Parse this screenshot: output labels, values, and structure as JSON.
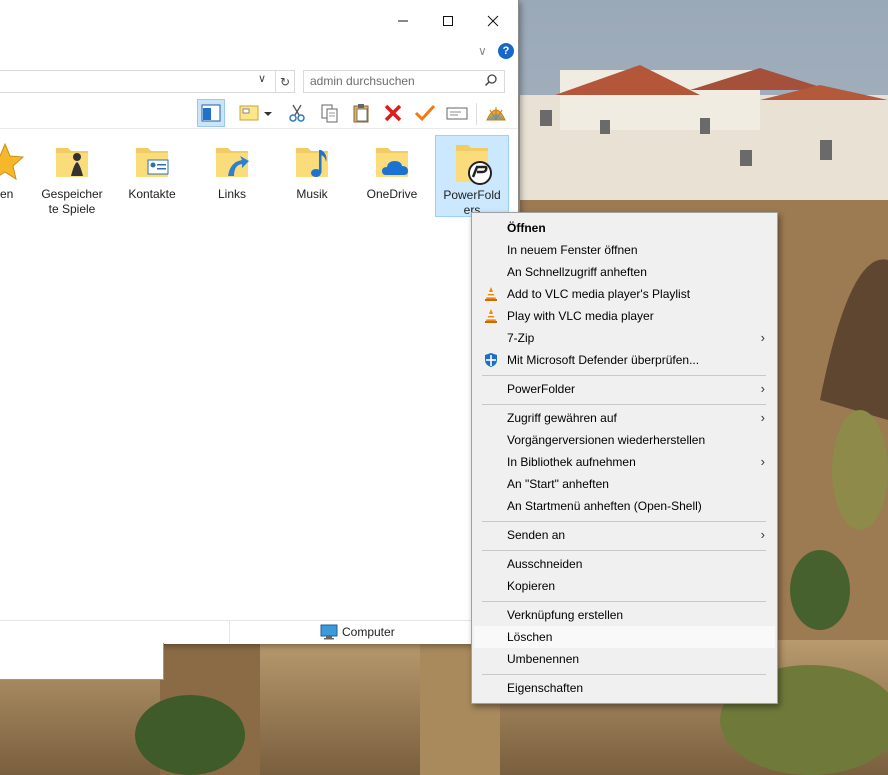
{
  "explorer": {
    "search_placeholder": "admin durchsuchen",
    "items": [
      {
        "label": "ten"
      },
      {
        "label": "Gespeicher\nte Spiele"
      },
      {
        "label": "Kontakte"
      },
      {
        "label": "Links"
      },
      {
        "label": "Musik"
      },
      {
        "label": "OneDrive"
      },
      {
        "label": "PowerFold\ners"
      }
    ],
    "status_location": "Computer"
  },
  "context_menu": {
    "open": "Öffnen",
    "open_new_window": "In neuem Fenster öffnen",
    "pin_quick_access": "An Schnellzugriff anheften",
    "vlc_playlist": "Add to VLC media player's Playlist",
    "vlc_play": "Play with VLC media player",
    "seven_zip": "7-Zip",
    "defender": "Mit Microsoft Defender überprüfen...",
    "powerfolder": "PowerFolder",
    "grant_access": "Zugriff gewähren auf",
    "restore_versions": "Vorgängerversionen wiederherstellen",
    "include_library": "In Bibliothek aufnehmen",
    "pin_start": "An \"Start\" anheften",
    "pin_startmenu": "An Startmenü anheften (Open-Shell)",
    "send_to": "Senden an",
    "cut": "Ausschneiden",
    "copy": "Kopieren",
    "create_shortcut": "Verknüpfung erstellen",
    "delete": "Löschen",
    "rename": "Umbenennen",
    "properties": "Eigenschaften"
  },
  "colors": {
    "selection": "#cce8ff",
    "accent_blue": "#1669c6",
    "menu_bg": "#f0f0f0"
  }
}
